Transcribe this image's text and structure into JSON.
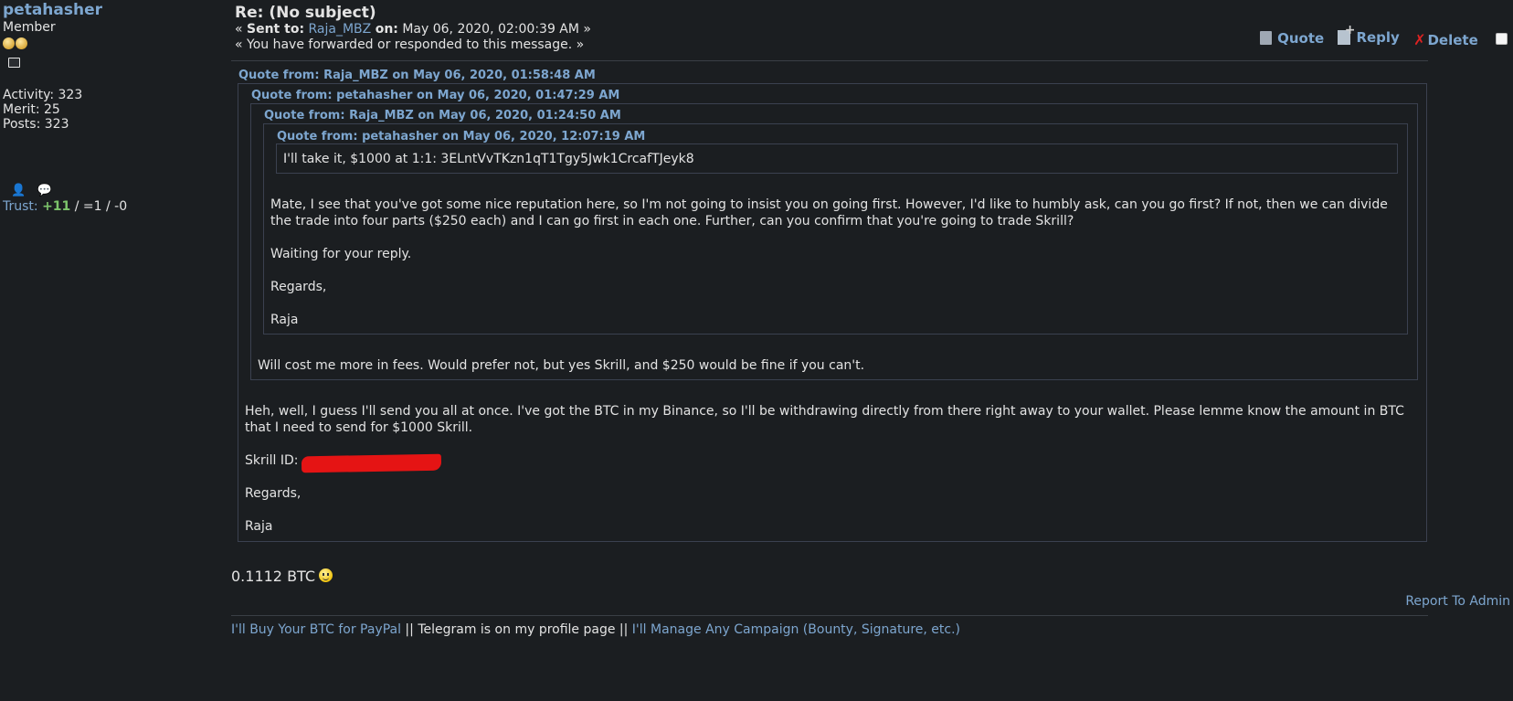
{
  "poster": {
    "username": "petahasher",
    "rank": "Member",
    "activity": "Activity: 323",
    "merit": "Merit: 25",
    "posts": "Posts: 323",
    "trust_label": "Trust:",
    "trust_positive": "+11",
    "trust_rest": " / =1 / -0"
  },
  "message": {
    "subject": "Re: (No subject)",
    "sent_prefix": "« ",
    "sent_to_label": "Sent to:",
    "sent_to_user": "Raja_MBZ",
    "on_label": "on:",
    "sent_date": "May 06, 2020, 02:00:39 AM »",
    "forwarded_note": "« You have forwarded or responded to this message. »"
  },
  "actions": {
    "quote": "Quote",
    "reply": "Reply",
    "delete": "Delete"
  },
  "quotes": {
    "q1_header": "Quote from: Raja_MBZ on May 06, 2020, 01:58:48 AM",
    "q2_header": "Quote from: petahasher on May 06, 2020, 01:47:29 AM",
    "q3_header": "Quote from: Raja_MBZ on May 06, 2020, 01:24:50 AM",
    "q4_header": "Quote from: petahasher on May 06, 2020, 12:07:19 AM",
    "q4_text": "I'll take it, $1000 at 1:1: 3ELntVvTKzn1qT1Tgy5Jwk1CrcafTJeyk8",
    "q3_p1": "Mate, I see that you've got some nice reputation here, so I'm not going to insist you on going first. However, I'd like to humbly ask, can you go first? If not, then we can divide the trade into four parts ($250 each) and I can go first in each one. Further, can you confirm that you're going to trade Skrill?",
    "q3_p2": "Waiting for your reply.",
    "q3_p3": "Regards,",
    "q3_p4": "Raja",
    "q2_text": "Will cost me more in fees. Would prefer not, but yes Skrill, and $250 would be fine if you can't.",
    "q1_p1": "Heh, well, I guess I'll send you all at once. I've got the BTC in my Binance, so I'll be withdrawing directly from there right away to your wallet. Please lemme know the amount in BTC that I need to send for $1000 Skrill.",
    "q1_skrill_label": "Skrill ID:",
    "q1_p3": "Regards,",
    "q1_p4": "Raja"
  },
  "body_text": "0.1112 BTC",
  "report": "Report To Admin",
  "signature": {
    "link1": "I'll Buy Your BTC for PayPal",
    "sep1": " || Telegram is on my profile page || ",
    "link2": "I'll Manage Any Campaign (Bounty, Signature, etc.)"
  },
  "colors": {
    "background": "#1b1e21",
    "link": "#7da6cf",
    "quote_border": "#3b4150",
    "redaction": "#e51414"
  }
}
